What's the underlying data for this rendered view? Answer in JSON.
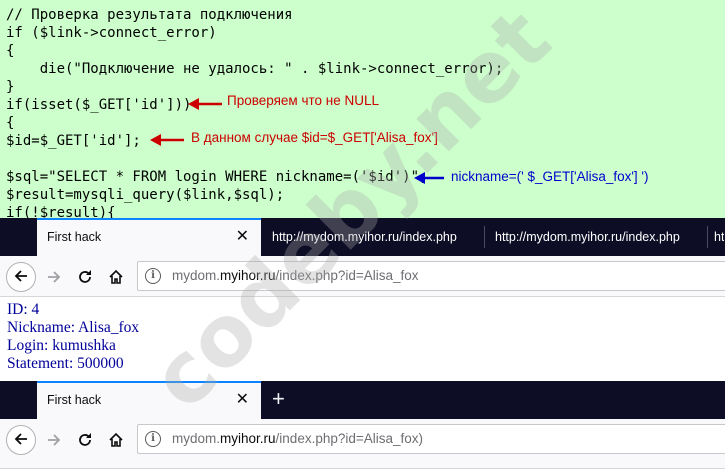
{
  "code": {
    "lines": [
      "// Проверка результата подключения",
      "if ($link->connect_error)",
      "{",
      "    die(\"Подключение не удалось: \" . $link->connect_error);",
      "}",
      "if(isset($_GET['id']))",
      "{",
      "$id=$_GET['id'];",
      "",
      "$sql=\"SELECT * FROM login WHERE nickname=('$id')\";",
      "$result=mysqli_query($link,$sql);",
      "if(!$result){"
    ],
    "annotations": {
      "isset": "Проверяем что не NULL",
      "id_assign": "В данном случае $id=$_GET['Alisa_fox']",
      "nickname": "nickname=(' $_GET['Alisa_fox'] ')"
    },
    "colors": {
      "background": "#ccffcc",
      "red_arrow": "#cc0000",
      "blue_arrow": "#0000cc"
    }
  },
  "watermark": "codeby.net",
  "browser1": {
    "tabs": [
      {
        "label": "First hack",
        "active": true,
        "close": "✕"
      },
      {
        "label": "http://mydom.myihor.ru/index.php",
        "active": false
      },
      {
        "label": "http://mydom.myihor.ru/index.php",
        "active": false
      },
      {
        "label": "ht",
        "active": false
      }
    ],
    "url": {
      "domain_prefix": "mydom.",
      "domain": "myihor.ru",
      "path": "/index.php?id=Alisa_fox"
    }
  },
  "page": {
    "lines": [
      "ID: 4",
      "Nickname: Alisa_fox",
      "Login: kumushka",
      "Statement: 500000"
    ]
  },
  "browser2": {
    "tabs": [
      {
        "label": "First hack",
        "active": true,
        "close": "✕"
      }
    ],
    "new_tab": "+",
    "url": {
      "domain_prefix": "mydom.",
      "domain": "myihor.ru",
      "path": "/index.php?id=Alisa_fox)"
    }
  },
  "icons": {
    "back": "back-arrow-icon",
    "forward": "forward-arrow-icon",
    "reload": "reload-icon",
    "home": "home-icon",
    "info": "info-icon"
  }
}
